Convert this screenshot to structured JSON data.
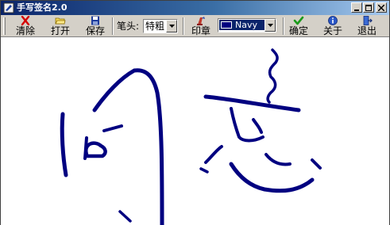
{
  "window": {
    "title": "手写签名2.0"
  },
  "toolbar": {
    "clear_label": "清除",
    "open_label": "打开",
    "save_label": "保存",
    "pen_label": "笔头:",
    "pen_value": "特粗",
    "stamp_label": "印章",
    "color_value": "Navy",
    "ok_label": "确定",
    "about_label": "关于",
    "exit_label": "退出"
  },
  "colors": {
    "ink": "#000080",
    "titlebar_start": "#0a246a",
    "titlebar_end": "#a6caf0",
    "face": "#d4d0c8"
  },
  "icons": {
    "clear": "red-x-icon",
    "open": "folder-icon",
    "save": "floppy-disk-icon",
    "stamp": "stamp-icon",
    "ok": "green-check-icon",
    "about": "info-icon",
    "exit": "exit-door-icon"
  }
}
